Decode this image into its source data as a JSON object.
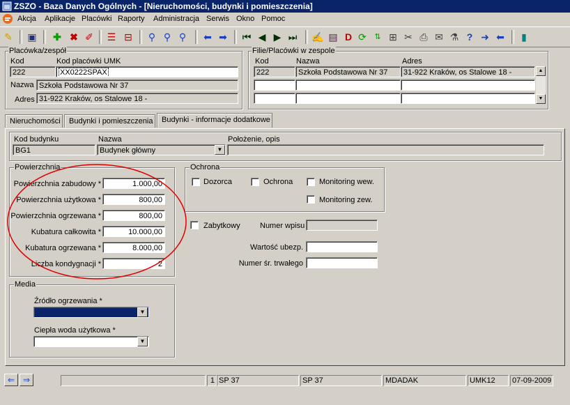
{
  "window": {
    "title": "ZSZO - Baza Danych Ogólnych - [Nieruchomości, budynki i pomieszczenia]"
  },
  "menu": [
    "Akcja",
    "Aplikacje",
    "Placówki",
    "Raporty",
    "Administracja",
    "Serwis",
    "Okno",
    "Pomoc"
  ],
  "placowka": {
    "group_title": "Placówka/zespół",
    "kod_label": "Kod",
    "kod_umk_label": "Kod placówki UMK",
    "kod": "222",
    "kod_umk": "XX0222SPAX",
    "nazwa_label": "Nazwa",
    "nazwa": "Szkoła Podstawowa Nr  37",
    "adres_label": "Adres",
    "adres": "31-922 Kraków, os Stalowe 18 -"
  },
  "filie": {
    "group_title": "Filie/Placówki w zespole",
    "col_kod": "Kod",
    "col_nazwa": "Nazwa",
    "col_adres": "Adres",
    "rows": [
      {
        "kod": "222",
        "nazwa": "Szkoła Podstawowa Nr  37",
        "adres": "31-922 Kraków, os Stalowe 18 -"
      },
      {
        "kod": "",
        "nazwa": "",
        "adres": ""
      },
      {
        "kod": "",
        "nazwa": "",
        "adres": ""
      }
    ]
  },
  "tabs": [
    "Nieruchomości",
    "Budynki i pomieszczenia",
    "Budynki - informacje dodatkowe"
  ],
  "budynek": {
    "kod_label": "Kod budynku",
    "kod": "BG1",
    "nazwa_label": "Nazwa",
    "nazwa": "Budynek główny",
    "polozenie_label": "Położenie, opis",
    "polozenie": ""
  },
  "powierzchnia": {
    "group_title": "Powierzchnia",
    "rows": [
      {
        "label": "Powierzchnia zabudowy *",
        "value": "1.000,00"
      },
      {
        "label": "Powierzchnia użytkowa *",
        "value": "800,00"
      },
      {
        "label": "Powierzchnia ogrzewana *",
        "value": "800,00"
      },
      {
        "label": "Kubatura całkowita *",
        "value": "10.000,00"
      },
      {
        "label": "Kubatura ogrzewana *",
        "value": "8.000,00"
      },
      {
        "label": "Liczba kondygnacji *",
        "value": "2"
      }
    ]
  },
  "media": {
    "group_title": "Media",
    "zrodlo_label": "Źródło ogrzewania *",
    "zrodlo_value": "",
    "woda_label": "Ciepła woda użytkowa *",
    "woda_value": ""
  },
  "ochrona": {
    "group_title": "Ochrona",
    "dozorca": "Dozorca",
    "ochrona": "Ochrona",
    "monitoring_wew": "Monitoring wew.",
    "monitoring_zew": "Monitoring zew."
  },
  "zabytek": {
    "zabytkowy": "Zabytkowy",
    "numer_wpisu": "Numer wpisu",
    "wartosc": "Wartość ubezp.",
    "numer_sr": "Numer śr. trwałego"
  },
  "status": {
    "cell1": "",
    "record": "1",
    "sp1": "SP 37",
    "sp2": "SP 37",
    "user": "MDADAK",
    "umk": "UMK12",
    "date": "07-09-2009"
  },
  "colors": {
    "titlebar": "#0a246a",
    "face": "#d4d0c8",
    "annotation": "#e00000",
    "selection": "#0a246a"
  }
}
